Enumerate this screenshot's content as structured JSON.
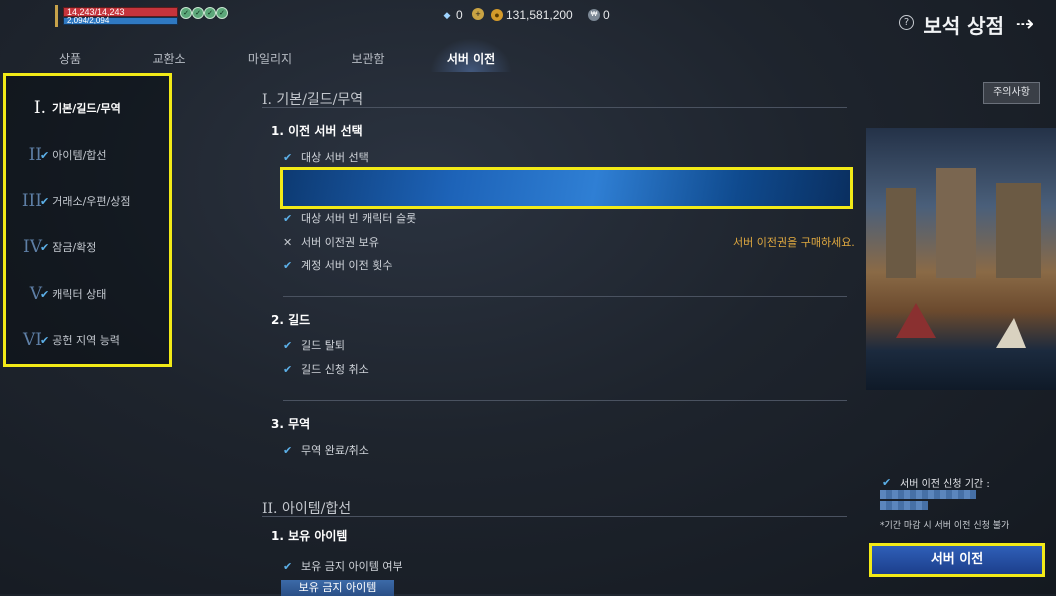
{
  "player": {
    "hp": "14,243/14,243",
    "mp": "2,094/2,094"
  },
  "currency": {
    "gem": "0",
    "gold": "131,581,200",
    "token": "0"
  },
  "header": {
    "title": "보석 상점"
  },
  "tabs": [
    {
      "label": "상품"
    },
    {
      "label": "교환소"
    },
    {
      "label": "마일리지"
    },
    {
      "label": "보관함"
    },
    {
      "label": "서버 이전"
    }
  ],
  "nav": [
    {
      "numeral": "I.",
      "label": "기본/길드/무역"
    },
    {
      "numeral": "II",
      "label": "아이템/합선"
    },
    {
      "numeral": "III",
      "label": "거래소/우편/상점"
    },
    {
      "numeral": "IV",
      "label": "잠금/확정"
    },
    {
      "numeral": "V",
      "label": "캐릭터 상태"
    },
    {
      "numeral": "VI",
      "label": "공헌 지역 능력"
    }
  ],
  "main": {
    "section1": "I. 기본/길드/무역",
    "transfer": {
      "heading": "1. 이전 서버 선택",
      "items": [
        "대상 서버 선택",
        "대상 서버 빈 캐릭터 슬롯",
        "서버 이전권 보유",
        "계정 서버 이전 횟수"
      ],
      "warning": "서버 이전권을 구매하세요."
    },
    "guild": {
      "heading": "2. 길드",
      "items": [
        "길드 탈퇴",
        "길드 신청 취소"
      ]
    },
    "trade": {
      "heading": "3. 무역",
      "items": [
        "무역 완료/취소"
      ]
    },
    "section2": "II. 아이템/합선",
    "owned": {
      "heading": "1. 보유 아이템",
      "items": [
        "보유 금지 아이템 여부"
      ],
      "button": "보유 금지 아이템"
    }
  },
  "right": {
    "notice": "주의사항",
    "period_label": "서버 이전 신청 기간 :",
    "period_note": "*기간 마감 시 서버 이전 신청 불가",
    "transfer_button": "서버 이전"
  },
  "colors": {
    "highlight": "#f2ea17",
    "check": "#5cb0e8",
    "warning": "#e0a940"
  }
}
